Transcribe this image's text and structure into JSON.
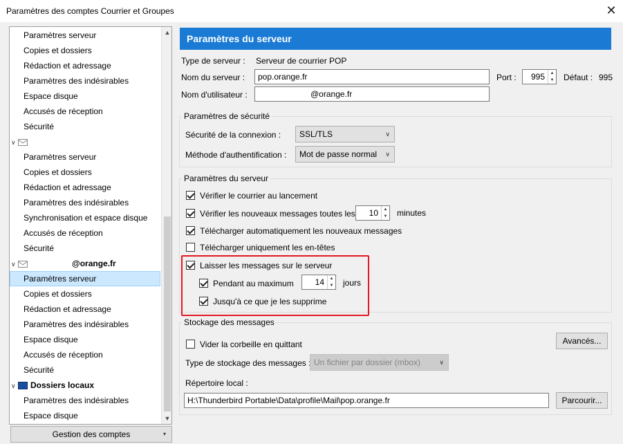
{
  "window": {
    "title": "Paramètres des comptes Courrier et Groupes"
  },
  "tree": {
    "section1": [
      "Paramètres serveur",
      "Copies et dossiers",
      "Rédaction et adressage",
      "Paramètres des indésirables",
      "Espace disque",
      "Accusés de réception",
      "Sécurité"
    ],
    "account2_items": [
      "Paramètres serveur",
      "Copies et dossiers",
      "Rédaction et adressage",
      "Paramètres des indésirables",
      "Synchronisation et espace disque",
      "Accusés de réception",
      "Sécurité"
    ],
    "account3_name": "@orange.fr",
    "account3_items": [
      "Paramètres serveur",
      "Copies et dossiers",
      "Rédaction et adressage",
      "Paramètres des indésirables",
      "Espace disque",
      "Accusés de réception",
      "Sécurité"
    ],
    "local_folders": "Dossiers locaux",
    "local_items": [
      "Paramètres des indésirables",
      "Espace disque"
    ],
    "manage_button": "Gestion des comptes"
  },
  "panel": {
    "header": "Paramètres du serveur",
    "server_type_label": "Type de serveur :",
    "server_type_value": "Serveur de courrier POP",
    "server_name_label": "Nom du serveur :",
    "server_name_value": "pop.orange.fr",
    "port_label": "Port :",
    "port_value": "995",
    "default_label": "Défaut :",
    "default_value": "995",
    "username_label": "Nom d'utilisateur :",
    "username_value": "@orange.fr"
  },
  "security": {
    "title": "Paramètres de sécurité",
    "connection_label": "Sécurité de la connexion :",
    "connection_value": "SSL/TLS",
    "auth_label": "Méthode d'authentification :",
    "auth_value": "Mot de passe normal"
  },
  "server_settings": {
    "title": "Paramètres du serveur",
    "check_startup": {
      "label": "Vérifier le courrier au lancement",
      "checked": true
    },
    "check_every": {
      "label": "Vérifier les nouveaux messages toutes les",
      "checked": true,
      "value": "10",
      "unit": "minutes"
    },
    "auto_download": {
      "label": "Télécharger automatiquement les nouveaux messages",
      "checked": true
    },
    "headers_only": {
      "label": "Télécharger uniquement les en-têtes",
      "checked": false
    },
    "leave_on_server": {
      "label": "Laisser les messages sur le serveur",
      "checked": true
    },
    "max_days": {
      "label": "Pendant au maximum",
      "checked": true,
      "value": "14",
      "unit": "jours"
    },
    "until_delete": {
      "label": "Jusqu'à ce que je les supprime",
      "checked": true
    }
  },
  "storage": {
    "title": "Stockage des messages",
    "empty_trash": {
      "label": "Vider la corbeille en quittant",
      "checked": false
    },
    "advanced_button": "Avancés...",
    "storage_type_label": "Type de stockage des messages :",
    "storage_type_value": "Un fichier par dossier (mbox)",
    "local_dir_label": "Répertoire local :",
    "local_dir_value": "H:\\Thunderbird Portable\\Data\\profile\\Mail\\pop.orange.fr",
    "browse_button": "Parcourir..."
  },
  "colors": {
    "header_blue": "#1a7ad4",
    "highlight_red": "#e3171f",
    "selection": "#cce8ff"
  }
}
